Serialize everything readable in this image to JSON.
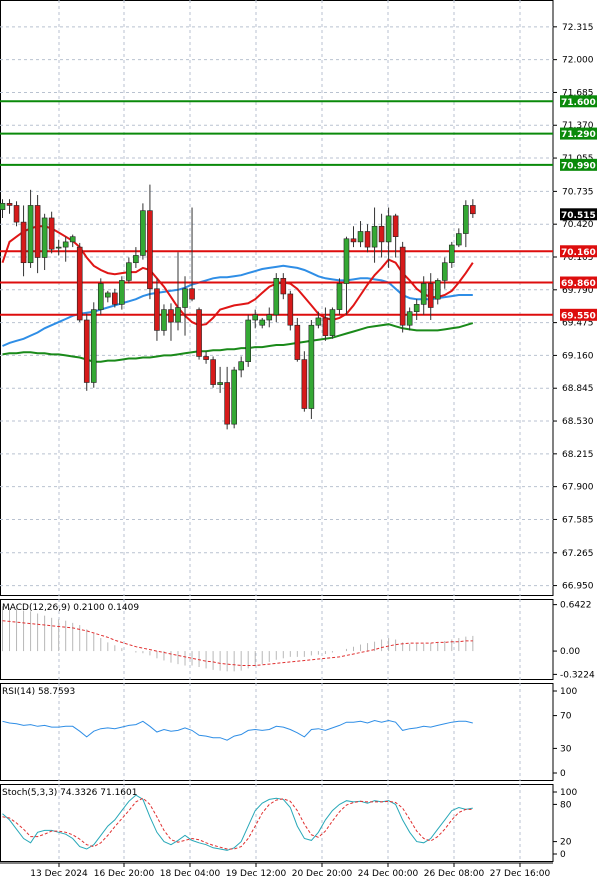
{
  "chart_data": {
    "type": "candlestick",
    "x_labels": [
      "13 Dec 2024",
      "16 Dec 20:00",
      "18 Dec 04:00",
      "19 Dec 12:00",
      "20 Dec 20:00",
      "24 Dec 00:00",
      "26 Dec 08:00",
      "27 Dec 16:00"
    ],
    "y_ticks": [
      "72.315",
      "72.000",
      "71.685",
      "71.370",
      "71.055",
      "70.735",
      "70.420",
      "70.105",
      "69.790",
      "69.475",
      "69.160",
      "68.845",
      "68.530",
      "68.215",
      "67.900",
      "67.585",
      "67.265",
      "66.950"
    ],
    "current_price": "70.515",
    "levels": [
      {
        "value": 71.6,
        "label": "71.600",
        "kind": "resistance"
      },
      {
        "value": 71.29,
        "label": "71.290",
        "kind": "resistance"
      },
      {
        "value": 70.99,
        "label": "70.990",
        "kind": "resistance"
      },
      {
        "value": 70.16,
        "label": "70.160",
        "kind": "support"
      },
      {
        "value": 69.86,
        "label": "69.860",
        "kind": "support"
      },
      {
        "value": 69.55,
        "label": "69.550",
        "kind": "support"
      }
    ],
    "candles": [
      [
        70.56,
        70.66,
        70.48,
        70.62
      ],
      [
        70.62,
        70.66,
        70.52,
        70.6
      ],
      [
        70.6,
        70.64,
        70.4,
        70.44
      ],
      [
        70.44,
        70.6,
        69.92,
        70.05
      ],
      [
        70.05,
        70.75,
        70.0,
        70.6
      ],
      [
        70.6,
        70.7,
        69.95,
        70.1
      ],
      [
        70.1,
        70.52,
        69.98,
        70.48
      ],
      [
        70.48,
        70.54,
        70.14,
        70.18
      ],
      [
        70.2,
        70.27,
        70.12,
        70.2
      ],
      [
        70.2,
        70.3,
        70.06,
        70.25
      ],
      [
        70.25,
        70.32,
        70.2,
        70.3
      ],
      [
        70.2,
        70.24,
        69.48,
        69.5
      ],
      [
        69.5,
        69.56,
        68.82,
        68.9
      ],
      [
        68.9,
        69.67,
        68.85,
        69.6
      ],
      [
        69.6,
        69.9,
        69.55,
        69.85
      ],
      [
        69.72,
        69.78,
        69.67,
        69.76
      ],
      [
        69.76,
        69.8,
        69.62,
        69.65
      ],
      [
        69.65,
        69.92,
        69.6,
        69.88
      ],
      [
        69.88,
        70.1,
        69.85,
        70.05
      ],
      [
        70.05,
        70.2,
        70.0,
        70.12
      ],
      [
        70.12,
        70.62,
        70.08,
        70.55
      ],
      [
        70.55,
        70.8,
        69.7,
        69.8
      ],
      [
        69.8,
        69.9,
        69.3,
        69.4
      ],
      [
        69.4,
        69.65,
        69.35,
        69.6
      ],
      [
        69.6,
        69.66,
        69.3,
        69.48
      ],
      [
        69.48,
        70.15,
        69.4,
        69.62
      ],
      [
        69.62,
        69.92,
        69.35,
        69.8
      ],
      [
        69.8,
        70.58,
        69.68,
        69.7
      ],
      [
        69.6,
        69.62,
        69.12,
        69.15
      ],
      [
        69.15,
        69.2,
        69.08,
        69.12
      ],
      [
        69.12,
        69.15,
        68.85,
        68.88
      ],
      [
        68.88,
        69.05,
        68.8,
        68.9
      ],
      [
        68.9,
        69.05,
        68.45,
        68.5
      ],
      [
        68.5,
        69.05,
        68.46,
        69.02
      ],
      [
        69.02,
        69.15,
        68.95,
        69.1
      ],
      [
        69.1,
        69.55,
        69.05,
        69.5
      ],
      [
        69.5,
        69.6,
        69.42,
        69.55
      ],
      [
        69.45,
        69.52,
        69.42,
        69.5
      ],
      [
        69.5,
        69.62,
        69.43,
        69.55
      ],
      [
        69.55,
        69.95,
        69.48,
        69.9
      ],
      [
        69.9,
        69.95,
        69.7,
        69.75
      ],
      [
        69.75,
        69.78,
        69.4,
        69.45
      ],
      [
        69.45,
        69.52,
        69.1,
        69.12
      ],
      [
        69.12,
        69.2,
        68.62,
        68.65
      ],
      [
        68.65,
        69.5,
        68.55,
        69.45
      ],
      [
        69.45,
        69.58,
        69.42,
        69.52
      ],
      [
        69.52,
        69.62,
        69.3,
        69.35
      ],
      [
        69.35,
        69.62,
        69.32,
        69.6
      ],
      [
        69.6,
        69.9,
        69.55,
        69.85
      ],
      [
        69.85,
        70.3,
        69.55,
        70.28
      ],
      [
        70.28,
        70.4,
        70.2,
        70.25
      ],
      [
        70.25,
        70.45,
        70.2,
        70.35
      ],
      [
        70.35,
        70.42,
        70.15,
        70.2
      ],
      [
        70.2,
        70.58,
        70.05,
        70.4
      ],
      [
        70.4,
        70.52,
        70.1,
        70.25
      ],
      [
        70.25,
        70.58,
        70.0,
        70.5
      ],
      [
        70.5,
        70.52,
        70.1,
        70.3
      ],
      [
        70.2,
        70.25,
        69.38,
        69.45
      ],
      [
        69.45,
        69.62,
        69.4,
        69.58
      ],
      [
        69.58,
        69.7,
        69.5,
        69.65
      ],
      [
        69.65,
        69.92,
        69.55,
        69.85
      ],
      [
        69.85,
        69.95,
        69.5,
        69.62
      ],
      [
        69.7,
        69.9,
        69.65,
        69.88
      ],
      [
        69.88,
        70.1,
        69.8,
        70.05
      ],
      [
        70.05,
        70.25,
        70.0,
        70.22
      ],
      [
        70.22,
        70.38,
        70.2,
        70.33
      ],
      [
        70.33,
        70.65,
        70.2,
        70.6
      ],
      [
        70.6,
        70.66,
        70.48,
        70.52
      ]
    ],
    "ma_red": [
      70.05,
      70.25,
      70.3,
      70.35,
      70.38,
      70.4,
      70.4,
      70.38,
      70.34,
      70.3,
      70.26,
      70.2,
      70.1,
      70.02,
      69.98,
      69.95,
      69.94,
      69.95,
      69.96,
      69.96,
      70.0,
      69.98,
      69.9,
      69.82,
      69.72,
      69.62,
      69.54,
      69.48,
      69.45,
      69.46,
      69.52,
      69.6,
      69.62,
      69.64,
      69.65,
      69.66,
      69.7,
      69.76,
      69.82,
      69.85,
      69.86,
      69.85,
      69.8,
      69.72,
      69.64,
      69.56,
      69.52,
      69.5,
      69.52,
      69.56,
      69.64,
      69.74,
      69.84,
      69.93,
      70.0,
      70.08,
      70.05,
      69.95,
      69.88,
      69.8,
      69.75,
      69.72,
      69.72,
      69.74,
      69.78,
      69.86,
      69.95,
      70.05
    ],
    "ma_blue": [
      69.25,
      69.28,
      69.3,
      69.32,
      69.35,
      69.38,
      69.42,
      69.45,
      69.48,
      69.51,
      69.54,
      69.56,
      69.57,
      69.58,
      69.6,
      69.62,
      69.64,
      69.66,
      69.68,
      69.7,
      69.73,
      69.75,
      69.76,
      69.77,
      69.78,
      69.79,
      69.81,
      69.84,
      69.86,
      69.88,
      69.9,
      69.91,
      69.91,
      69.92,
      69.93,
      69.95,
      69.97,
      69.99,
      70.0,
      70.01,
      70.02,
      70.01,
      70.0,
      69.98,
      69.95,
      69.92,
      69.9,
      69.89,
      69.88,
      69.88,
      69.89,
      69.9,
      69.9,
      69.89,
      69.88,
      69.86,
      69.8,
      69.74,
      69.71,
      69.7,
      69.7,
      69.7,
      69.71,
      69.72,
      69.73,
      69.74,
      69.74,
      69.74
    ],
    "ma_green": [
      69.17,
      69.18,
      69.18,
      69.19,
      69.19,
      69.18,
      69.18,
      69.17,
      69.17,
      69.16,
      69.15,
      69.14,
      69.12,
      69.1,
      69.1,
      69.11,
      69.11,
      69.12,
      69.13,
      69.13,
      69.14,
      69.14,
      69.15,
      69.16,
      69.16,
      69.17,
      69.18,
      69.19,
      69.2,
      69.2,
      69.21,
      69.21,
      69.22,
      69.22,
      69.23,
      69.23,
      69.24,
      69.24,
      69.25,
      69.26,
      69.26,
      69.27,
      69.28,
      69.29,
      69.3,
      69.31,
      69.32,
      69.33,
      69.35,
      69.37,
      69.39,
      69.41,
      69.43,
      69.44,
      69.45,
      69.46,
      69.44,
      69.42,
      69.41,
      69.4,
      69.4,
      69.4,
      69.4,
      69.41,
      69.42,
      69.43,
      69.45,
      69.47
    ],
    "macd": {
      "label": "MACD(12,26,9) 0.2100 0.1409",
      "ticks": [
        "0.6422",
        "0.00",
        "-0.3224"
      ],
      "ylim": [
        -0.3224,
        0.6422
      ],
      "hist": [
        0.62,
        0.6,
        0.58,
        0.56,
        0.55,
        0.52,
        0.49,
        0.46,
        0.44,
        0.42,
        0.39,
        0.36,
        0.3,
        0.24,
        0.18,
        0.12,
        0.08,
        0.04,
        0.0,
        -0.02,
        -0.03,
        -0.06,
        -0.1,
        -0.13,
        -0.16,
        -0.18,
        -0.2,
        -0.2,
        -0.22,
        -0.24,
        -0.26,
        -0.27,
        -0.28,
        -0.28,
        -0.27,
        -0.24,
        -0.21,
        -0.18,
        -0.15,
        -0.12,
        -0.1,
        -0.08,
        -0.08,
        -0.08,
        -0.06,
        -0.05,
        -0.04,
        -0.02,
        0.0,
        0.03,
        0.06,
        0.09,
        0.11,
        0.13,
        0.16,
        0.18,
        0.16,
        0.12,
        0.1,
        0.1,
        0.1,
        0.11,
        0.12,
        0.14,
        0.16,
        0.18,
        0.2,
        0.21
      ],
      "signal": [
        0.42,
        0.41,
        0.4,
        0.39,
        0.38,
        0.37,
        0.36,
        0.35,
        0.34,
        0.33,
        0.32,
        0.3,
        0.28,
        0.25,
        0.22,
        0.19,
        0.15,
        0.12,
        0.09,
        0.06,
        0.04,
        0.02,
        0.0,
        -0.02,
        -0.04,
        -0.06,
        -0.08,
        -0.1,
        -0.12,
        -0.14,
        -0.15,
        -0.17,
        -0.18,
        -0.19,
        -0.2,
        -0.2,
        -0.2,
        -0.19,
        -0.18,
        -0.17,
        -0.16,
        -0.15,
        -0.14,
        -0.13,
        -0.12,
        -0.11,
        -0.1,
        -0.09,
        -0.08,
        -0.06,
        -0.04,
        -0.02,
        0.0,
        0.02,
        0.05,
        0.07,
        0.09,
        0.1,
        0.11,
        0.11,
        0.11,
        0.11,
        0.12,
        0.12,
        0.13,
        0.13,
        0.14,
        0.14
      ]
    },
    "rsi": {
      "label": "RSI(14) 58.7593",
      "ticks": [
        "100",
        "70",
        "30",
        "0"
      ],
      "ylim": [
        0,
        100
      ],
      "values": [
        63,
        61,
        60,
        58,
        59,
        57,
        58,
        56,
        56,
        57,
        57,
        51,
        44,
        51,
        54,
        55,
        54,
        56,
        58,
        59,
        63,
        57,
        50,
        53,
        51,
        52,
        55,
        52,
        46,
        45,
        43,
        43,
        40,
        45,
        47,
        52,
        53,
        52,
        53,
        57,
        56,
        53,
        49,
        44,
        53,
        54,
        52,
        55,
        58,
        62,
        62,
        63,
        61,
        64,
        62,
        64,
        62,
        52,
        54,
        55,
        57,
        56,
        58,
        60,
        62,
        63,
        63,
        61
      ]
    },
    "stoch": {
      "label": "Stoch(5,3,3) 74.3326 71.1601",
      "ticks": [
        "100",
        "80",
        "20",
        "0"
      ],
      "ylim": [
        0,
        100
      ],
      "k": [
        65,
        55,
        40,
        25,
        18,
        35,
        38,
        38,
        35,
        32,
        25,
        12,
        8,
        15,
        30,
        45,
        55,
        70,
        85,
        95,
        88,
        60,
        35,
        20,
        15,
        22,
        30,
        22,
        18,
        15,
        10,
        8,
        6,
        10,
        20,
        45,
        70,
        82,
        88,
        90,
        88,
        75,
        45,
        25,
        22,
        35,
        55,
        70,
        80,
        86,
        84,
        85,
        82,
        86,
        84,
        86,
        80,
        55,
        35,
        20,
        18,
        25,
        40,
        55,
        70,
        75,
        72,
        74
      ],
      "d": [
        60,
        58,
        50,
        40,
        28,
        28,
        32,
        37,
        37,
        35,
        31,
        24,
        15,
        12,
        18,
        30,
        44,
        57,
        70,
        84,
        90,
        80,
        60,
        38,
        23,
        19,
        22,
        25,
        23,
        18,
        14,
        11,
        8,
        8,
        12,
        25,
        45,
        66,
        80,
        87,
        89,
        85,
        70,
        48,
        31,
        27,
        37,
        53,
        68,
        79,
        83,
        85,
        84,
        84,
        84,
        85,
        83,
        74,
        56,
        37,
        25,
        21,
        28,
        40,
        55,
        67,
        72,
        72
      ]
    }
  }
}
